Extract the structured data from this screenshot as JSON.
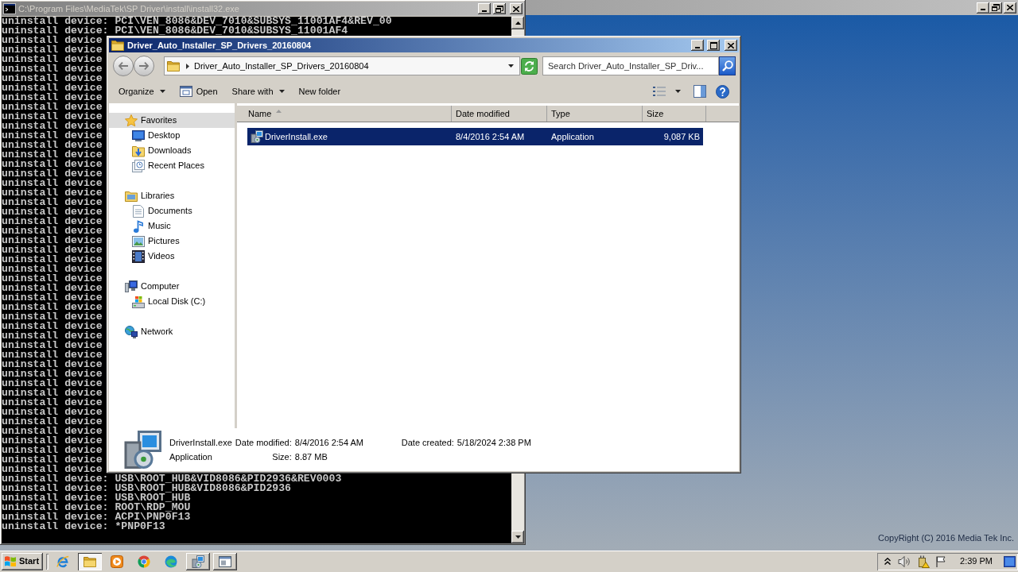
{
  "console": {
    "title": "C:\\Program Files\\MediaTek\\SP Driver\\install\\install32.exe",
    "lines": [
      "uninstall device: PCI\\VEN_8086&DEV_7010&SUBSYS_11001AF4&REV_00",
      "uninstall device: PCI\\VEN_8086&DEV_7010&SUBSYS_11001AF4",
      "uninstall device",
      "uninstall device",
      "uninstall device",
      "uninstall device",
      "uninstall device",
      "uninstall device",
      "uninstall device",
      "uninstall device",
      "uninstall device",
      "uninstall device",
      "uninstall device",
      "uninstall device",
      "uninstall device",
      "uninstall device",
      "uninstall device",
      "uninstall device",
      "uninstall device",
      "uninstall device",
      "uninstall device",
      "uninstall device",
      "uninstall device",
      "uninstall device",
      "uninstall device",
      "uninstall device",
      "uninstall device",
      "uninstall device",
      "uninstall device",
      "uninstall device",
      "uninstall device",
      "uninstall device",
      "uninstall device",
      "uninstall device",
      "uninstall device",
      "uninstall device",
      "uninstall device",
      "uninstall device",
      "uninstall device",
      "uninstall device",
      "uninstall device",
      "uninstall device",
      "uninstall device",
      "uninstall device",
      "uninstall device",
      "uninstall device",
      "uninstall device",
      "uninstall device",
      "uninstall device: USB\\ROOT_HUB&VID8086&PID2936&REV0003",
      "uninstall device: USB\\ROOT_HUB&VID8086&PID2936",
      "uninstall device: USB\\ROOT_HUB",
      "uninstall device: ROOT\\RDP_MOU",
      "uninstall device: ACPI\\PNP0F13",
      "uninstall device: *PNP0F13"
    ]
  },
  "background_window": {
    "copyright": "CopyRight (C) 2016 Media Tek Inc."
  },
  "explorer": {
    "title": "Driver_Auto_Installer_SP_Drivers_20160804",
    "address": {
      "path": "Driver_Auto_Installer_SP_Drivers_20160804"
    },
    "search": {
      "placeholder": "Search Driver_Auto_Installer_SP_Driv..."
    },
    "toolbar": [
      {
        "label": "Organize",
        "kind": "menu"
      },
      {
        "label": "Open",
        "kind": "open"
      },
      {
        "label": "Share with",
        "kind": "menu"
      },
      {
        "label": "New folder",
        "kind": "plain"
      }
    ],
    "nav": [
      {
        "label": "Favorites",
        "kind": "favorites",
        "selected": true,
        "children": [
          {
            "label": "Desktop",
            "kind": "desktop",
            "selected": false
          },
          {
            "label": "Downloads",
            "kind": "downloads",
            "selected": false
          },
          {
            "label": "Recent Places",
            "kind": "recent",
            "selected": false
          }
        ]
      },
      {
        "label": "Libraries",
        "kind": "libraries",
        "selected": false,
        "children": [
          {
            "label": "Documents",
            "kind": "documents",
            "selected": false
          },
          {
            "label": "Music",
            "kind": "music",
            "selected": false
          },
          {
            "label": "Pictures",
            "kind": "pictures",
            "selected": false
          },
          {
            "label": "Videos",
            "kind": "videos",
            "selected": false
          }
        ]
      },
      {
        "label": "Computer",
        "kind": "computer",
        "selected": false,
        "children": [
          {
            "label": "Local Disk (C:)",
            "kind": "disk",
            "selected": false
          }
        ]
      },
      {
        "label": "Network",
        "kind": "network",
        "selected": false
      }
    ],
    "columns": [
      {
        "label": "Name",
        "sorted": true
      },
      {
        "label": "Date modified",
        "sorted": false
      },
      {
        "label": "Type",
        "sorted": false
      },
      {
        "label": "Size",
        "sorted": false
      }
    ],
    "files": [
      {
        "name": "DriverInstall.exe",
        "date_modified": "8/4/2016 2:54 AM",
        "type": "Application",
        "size": "9,087 KB",
        "selected": true
      }
    ],
    "details": {
      "name": "DriverInstall.exe",
      "type": "Application",
      "fields": [
        {
          "label": "Date modified:",
          "value": "8/4/2016 2:54 AM"
        },
        {
          "label": "Size:",
          "value": "8.87 MB"
        },
        {
          "label": "Date created:",
          "value": "5/18/2024 2:38 PM"
        }
      ]
    }
  },
  "taskbar": {
    "start": "Start",
    "items": [
      {
        "kind": "browser_e",
        "open": false,
        "selected": false
      },
      {
        "kind": "folder",
        "open": true,
        "selected": true
      },
      {
        "kind": "player",
        "open": false,
        "selected": false
      },
      {
        "kind": "browser_ring",
        "open": false,
        "selected": false
      },
      {
        "kind": "browser_wave",
        "open": false,
        "selected": false
      },
      {
        "kind": "installer",
        "open": true,
        "selected": false
      },
      {
        "kind": "window",
        "open": true,
        "selected": false
      }
    ],
    "clock": "2:39 PM"
  }
}
